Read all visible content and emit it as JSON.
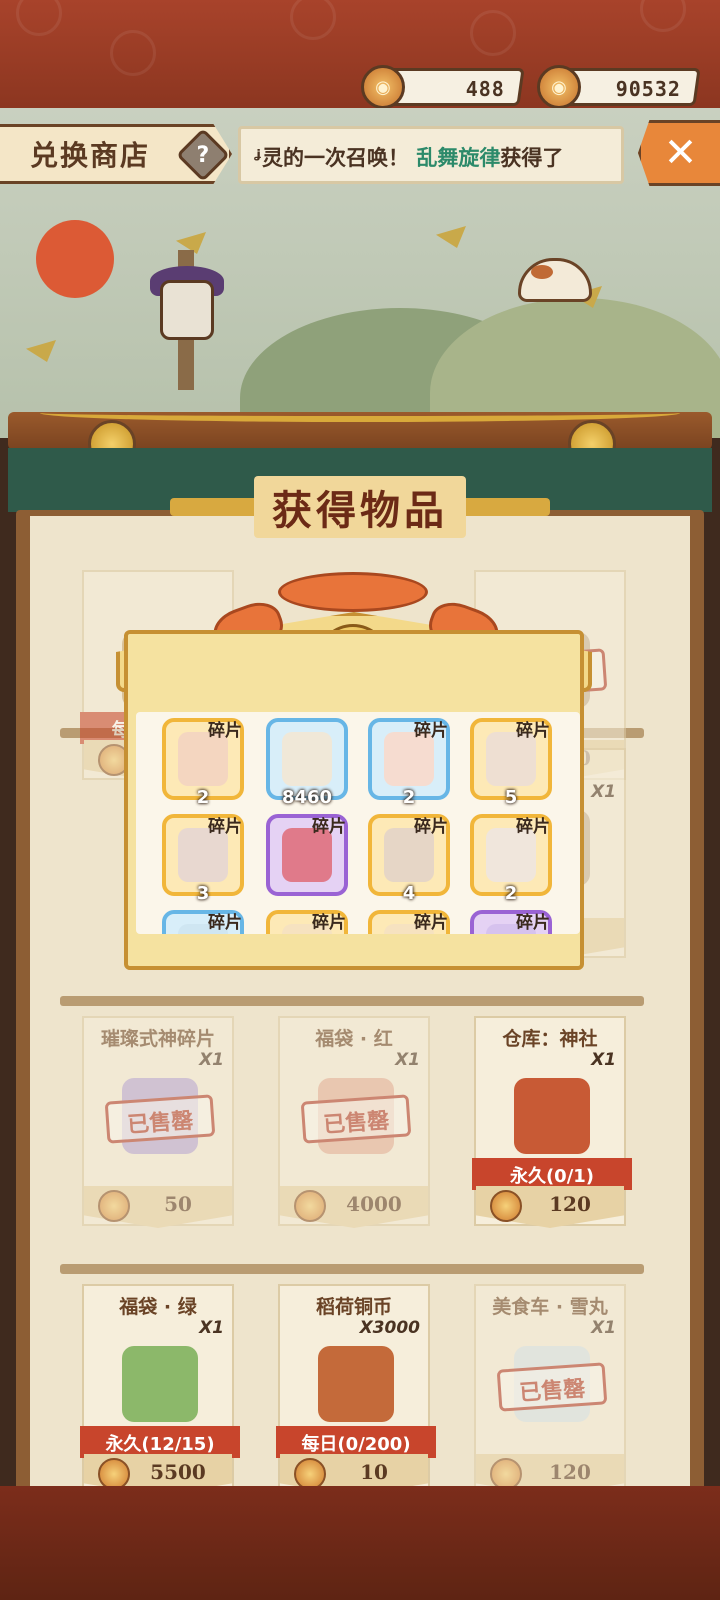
{
  "header": {
    "currency_a": {
      "icon": "jade-coin-icon",
      "amount": "488"
    },
    "currency_b": {
      "icon": "copper-coin-icon",
      "amount": "90532"
    }
  },
  "shop": {
    "title": "兑换商店",
    "help_icon": "?",
    "ticker_prefix": "ᶨ灵的一次召唤！",
    "ticker_highlight": "乱舞旋律",
    "ticker_suffix": "获得了",
    "close_icon": "✕"
  },
  "popup": {
    "title": "获得物品",
    "items": [
      {
        "tag": "碎片",
        "count": "2",
        "style": "gold"
      },
      {
        "tag": "",
        "count": "8460",
        "style": "blue"
      },
      {
        "tag": "碎片",
        "count": "2",
        "style": "blue"
      },
      {
        "tag": "碎片",
        "count": "5",
        "style": "gold"
      },
      {
        "tag": "碎片",
        "count": "3",
        "style": "gold"
      },
      {
        "tag": "碎片",
        "count": "",
        "style": "purple"
      },
      {
        "tag": "碎片",
        "count": "4",
        "style": "gold"
      },
      {
        "tag": "碎片",
        "count": "2",
        "style": "gold"
      },
      {
        "tag": "碎片",
        "count": "",
        "style": "blue"
      },
      {
        "tag": "碎片",
        "count": "",
        "style": "gold"
      },
      {
        "tag": "碎片",
        "count": "",
        "style": "gold"
      },
      {
        "tag": "碎片",
        "count": "",
        "style": "purple"
      }
    ]
  },
  "shop_items": [
    {
      "name": "",
      "qty": "",
      "limit": "每日(0/20)",
      "price": "",
      "sold": false,
      "faded": true
    },
    {
      "name": "",
      "qty": "",
      "limit": "",
      "price": "700",
      "sold": true,
      "faded": true
    },
    {
      "name": "",
      "qty": "X1",
      "limit": "",
      "price": "",
      "sold": false,
      "faded": true
    },
    {
      "name": "璀璨式神碎片",
      "qty": "X1",
      "limit": "",
      "price": "50",
      "sold": true,
      "faded": true
    },
    {
      "name": "福袋 · 红",
      "qty": "X1",
      "limit": "",
      "price": "4000",
      "sold": true,
      "faded": true
    },
    {
      "name": "仓库：神社",
      "qty": "X1",
      "limit": "永久(0/1)",
      "price": "120",
      "sold": false,
      "faded": false
    },
    {
      "name": "福袋 · 绿",
      "qty": "X1",
      "limit": "永久(12/15)",
      "price": "5500",
      "sold": false,
      "faded": false
    },
    {
      "name": "稻荷铜币",
      "qty": "X3000",
      "limit": "每日(0/200)",
      "price": "10",
      "sold": false,
      "faded": false
    },
    {
      "name": "美食车 · 雪丸",
      "qty": "X1",
      "limit": "",
      "price": "120",
      "sold": true,
      "faded": true
    }
  ],
  "sold_label": "已售罄"
}
